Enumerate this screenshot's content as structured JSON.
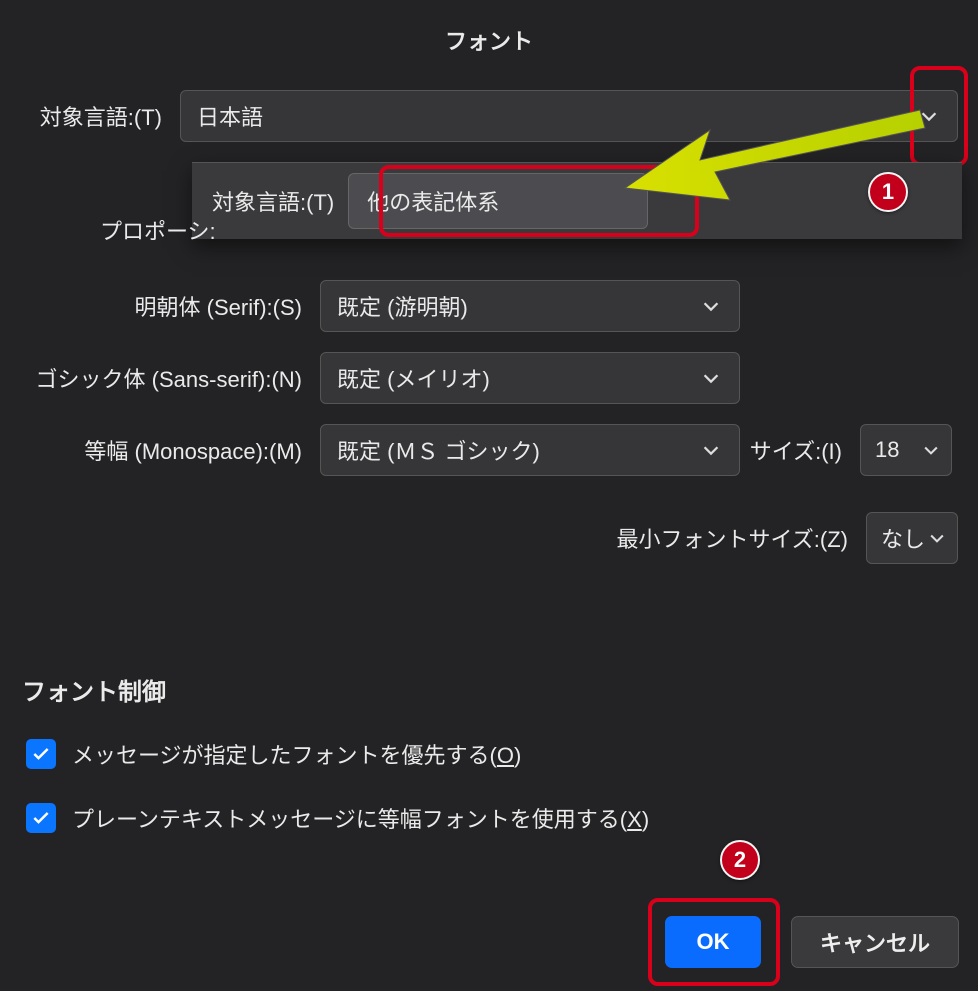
{
  "title": "フォント",
  "lang": {
    "label": "対象言語:(T)",
    "value": "日本語"
  },
  "dropdown": {
    "inner_label": "対象言語:(T)",
    "option": "他の表記体系"
  },
  "proportional_label": "プロポーシ:",
  "serif": {
    "label": "明朝体 (Serif):(S)",
    "value": "既定 (游明朝)"
  },
  "sans": {
    "label": "ゴシック体 (Sans-serif):(N)",
    "value": "既定 (メイリオ)"
  },
  "mono": {
    "label": "等幅 (Monospace):(M)",
    "value": "既定 (ＭＳ ゴシック)"
  },
  "size": {
    "label": "サイズ:(I)",
    "value": "18"
  },
  "min_size": {
    "label": "最小フォントサイズ:(Z)",
    "value": "なし"
  },
  "control_header": "フォント制御",
  "opt1_pre": "メッセージが指定したフォントを優先する(",
  "opt1_key": "O",
  "opt1_post": ")",
  "opt2_pre": "プレーンテキストメッセージに等幅フォントを使用する(",
  "opt2_key": "X",
  "opt2_post": ")",
  "buttons": {
    "ok": "OK",
    "cancel": "キャンセル"
  },
  "badges": {
    "one": "1",
    "two": "2"
  }
}
